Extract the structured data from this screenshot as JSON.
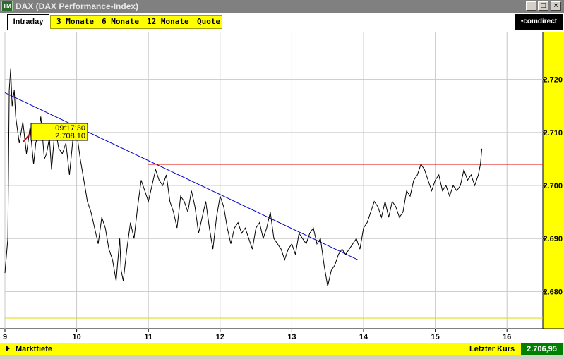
{
  "window": {
    "title": "DAX (DAX Performance-Index)",
    "app_icon": "TM",
    "controls": [
      "_",
      "□",
      "×"
    ]
  },
  "toolbar": {
    "tabs": [
      {
        "label": "Intraday",
        "active": true
      },
      {
        "label": "3 Monate",
        "active": false
      },
      {
        "label": "6 Monate",
        "active": false
      },
      {
        "label": "12 Monate",
        "active": false
      },
      {
        "label": "Quote",
        "active": false
      }
    ],
    "logo": "•comdirect"
  },
  "tooltip": {
    "time": "09:17:30",
    "value": "2.708,10"
  },
  "footer": {
    "left_label": "Markttiefe",
    "right_label": "Letzter Kurs",
    "last_value": "2.706,95"
  },
  "colors": {
    "accent_yellow": "#ffff00",
    "price_line": "#000000",
    "trend_line": "#0000cc",
    "resistance_line": "#dd0000",
    "support_line": "#dddd00",
    "last_value_bg": "#008000"
  },
  "chart_data": {
    "type": "line",
    "xlabel": "",
    "ylabel": "",
    "xlim": [
      9,
      16.5
    ],
    "ylim": [
      2673,
      2729
    ],
    "x_ticks": [
      {
        "value": 9,
        "label": "9"
      },
      {
        "value": 10,
        "label": "10"
      },
      {
        "value": 11,
        "label": "11"
      },
      {
        "value": 12,
        "label": "12"
      },
      {
        "value": 13,
        "label": "13"
      },
      {
        "value": 14,
        "label": "14"
      },
      {
        "value": 15,
        "label": "15"
      },
      {
        "value": 16,
        "label": "16"
      }
    ],
    "y_ticks": [
      {
        "value": 2680,
        "label": "2.680"
      },
      {
        "value": 2690,
        "label": "2.690"
      },
      {
        "value": 2700,
        "label": "2.700"
      },
      {
        "value": 2710,
        "label": "2.710"
      },
      {
        "value": 2720,
        "label": "2.720"
      }
    ],
    "grid": true,
    "series": [
      {
        "x": [
          9.0,
          9.04,
          9.06,
          9.08,
          9.1,
          9.13,
          9.15,
          9.2,
          9.25,
          9.3,
          9.35,
          9.4,
          9.43,
          9.47,
          9.5,
          9.55,
          9.58,
          9.62,
          9.65,
          9.7,
          9.75,
          9.8,
          9.85,
          9.9,
          9.95,
          10.0,
          10.05,
          10.1,
          10.15,
          10.2,
          10.25,
          10.3,
          10.35,
          10.4,
          10.45,
          10.5,
          10.55,
          10.6,
          10.62,
          10.65,
          10.7,
          10.75,
          10.8,
          10.85,
          10.9,
          10.95,
          11.0,
          11.05,
          11.1,
          11.15,
          11.2,
          11.25,
          11.3,
          11.35,
          11.4,
          11.45,
          11.5,
          11.55,
          11.6,
          11.65,
          11.7,
          11.75,
          11.8,
          11.85,
          11.9,
          11.95,
          12.0,
          12.05,
          12.1,
          12.15,
          12.2,
          12.25,
          12.3,
          12.35,
          12.4,
          12.45,
          12.5,
          12.55,
          12.6,
          12.65,
          12.7,
          12.75,
          12.8,
          12.85,
          12.9,
          12.95,
          13.0,
          13.05,
          13.1,
          13.15,
          13.2,
          13.25,
          13.3,
          13.35,
          13.4,
          13.45,
          13.5,
          13.55,
          13.6,
          13.65,
          13.7,
          13.75,
          13.8,
          13.85,
          13.9,
          13.95,
          14.0,
          14.05,
          14.1,
          14.15,
          14.2,
          14.25,
          14.3,
          14.35,
          14.4,
          14.45,
          14.5,
          14.55,
          14.6,
          14.65,
          14.7,
          14.75,
          14.8,
          14.85,
          14.9,
          14.95,
          15.0,
          15.05,
          15.1,
          15.15,
          15.2,
          15.25,
          15.3,
          15.35,
          15.4,
          15.45,
          15.5,
          15.55,
          15.6,
          15.63,
          15.65
        ],
        "values": [
          2683.5,
          2690,
          2718,
          2722,
          2715,
          2718,
          2713,
          2708,
          2712,
          2706,
          2711,
          2704,
          2708,
          2710,
          2713,
          2705,
          2706,
          2709,
          2703,
          2711,
          2707,
          2706,
          2708,
          2702,
          2709,
          2710,
          2705,
          2701,
          2697,
          2695,
          2692,
          2689,
          2694,
          2692,
          2688,
          2686,
          2682,
          2690,
          2684,
          2682,
          2688,
          2693,
          2690,
          2696,
          2701,
          2699,
          2697,
          2700,
          2703,
          2701,
          2700,
          2702,
          2697,
          2695,
          2692,
          2698,
          2697,
          2695,
          2699,
          2696,
          2691,
          2694,
          2697,
          2692,
          2688,
          2694,
          2698,
          2696,
          2692,
          2689,
          2692,
          2693,
          2691,
          2692,
          2690,
          2688,
          2692,
          2693,
          2690,
          2692,
          2695,
          2690,
          2689,
          2688,
          2686,
          2688,
          2689,
          2687,
          2691,
          2690,
          2689,
          2691,
          2692,
          2689,
          2690,
          2685,
          2681,
          2684,
          2685,
          2687,
          2688,
          2687,
          2688,
          2689,
          2690,
          2688,
          2692,
          2693,
          2695,
          2697,
          2696,
          2694,
          2697,
          2694,
          2697,
          2696,
          2694,
          2695,
          2699,
          2698,
          2701,
          2702,
          2704,
          2703,
          2701,
          2699,
          2701,
          2702,
          2699,
          2700,
          2698,
          2700,
          2699,
          2700,
          2703,
          2701,
          2702,
          2700,
          2702,
          2704,
          2706.95
        ]
      }
    ],
    "annotations": [
      {
        "type": "trend_line",
        "color": "#0000cc",
        "from": [
          9.0,
          2717.5
        ],
        "to": [
          13.92,
          2686
        ]
      },
      {
        "type": "horizontal_line",
        "color": "#dd0000",
        "y": 2704,
        "x_from": 11.0,
        "x_to": 16.5
      },
      {
        "type": "horizontal_line",
        "color": "#dddd00",
        "y": 2675,
        "x_from": 9.0,
        "x_to": 16.5
      }
    ]
  }
}
